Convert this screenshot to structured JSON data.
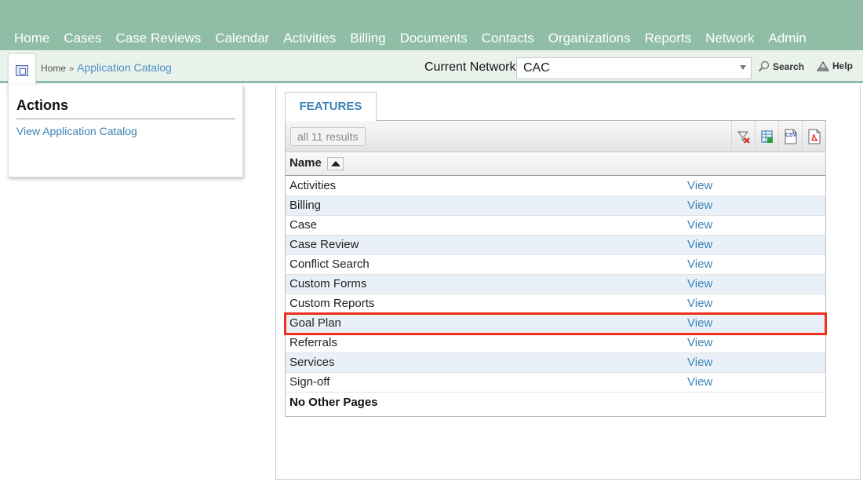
{
  "nav": {
    "items": [
      "Home",
      "Cases",
      "Case Reviews",
      "Calendar",
      "Activities",
      "Billing",
      "Documents",
      "Contacts",
      "Organizations",
      "Reports",
      "Network",
      "Admin"
    ]
  },
  "breadcrumb": {
    "home": "Home",
    "separator": "»",
    "current": "Application Catalog"
  },
  "network": {
    "label": "Current Network",
    "selected": "CAC"
  },
  "tools": {
    "search": "Search",
    "help": "Help"
  },
  "actions": {
    "title": "Actions",
    "link": "View Application Catalog"
  },
  "main": {
    "tab": "FEATURES",
    "results": "all 11 results",
    "column_name": "Name",
    "toolbar_icons": [
      "clear-filter-icon",
      "excel-export-icon",
      "csv-export-icon",
      "pdf-export-icon"
    ],
    "csv_label": "CSV",
    "rows": [
      {
        "name": "Activities",
        "action": "View"
      },
      {
        "name": "Billing",
        "action": "View"
      },
      {
        "name": "Case",
        "action": "View"
      },
      {
        "name": "Case Review",
        "action": "View"
      },
      {
        "name": "Conflict Search",
        "action": "View"
      },
      {
        "name": "Custom Forms",
        "action": "View"
      },
      {
        "name": "Custom Reports",
        "action": "View"
      },
      {
        "name": "Goal Plan",
        "action": "View"
      },
      {
        "name": "Referrals",
        "action": "View"
      },
      {
        "name": "Services",
        "action": "View"
      },
      {
        "name": "Sign-off",
        "action": "View"
      }
    ],
    "highlighted_row": "Goal Plan",
    "footer": "No Other Pages"
  },
  "colors": {
    "nav_bg": "#8fbda6",
    "link": "#3b82b5",
    "highlight": "#f0301e",
    "alt_row": "#e9f0f8"
  }
}
